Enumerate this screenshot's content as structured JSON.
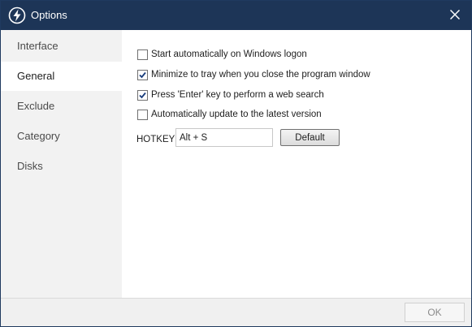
{
  "window": {
    "title": "Options",
    "icon": "lightning-bolt-icon",
    "close_icon": "close-icon"
  },
  "sidebar": {
    "active_index": 1,
    "items": [
      {
        "label": "Interface"
      },
      {
        "label": "General"
      },
      {
        "label": "Exclude"
      },
      {
        "label": "Category"
      },
      {
        "label": "Disks"
      }
    ]
  },
  "general": {
    "options": [
      {
        "label": "Start automatically on Windows logon",
        "checked": false
      },
      {
        "label": "Minimize to tray when you close the program window",
        "checked": true
      },
      {
        "label": "Press 'Enter' key to perform a web search",
        "checked": true
      },
      {
        "label": "Automatically update to the latest version",
        "checked": false
      }
    ],
    "hotkey_label": "HOTKEY",
    "hotkey_value": "Alt + S",
    "default_button": "Default"
  },
  "footer": {
    "ok_label": "OK"
  },
  "colors": {
    "titlebar": "#1d3557",
    "sidebar_bg": "#f2f2f2",
    "check_mark": "#1a3d7c"
  }
}
